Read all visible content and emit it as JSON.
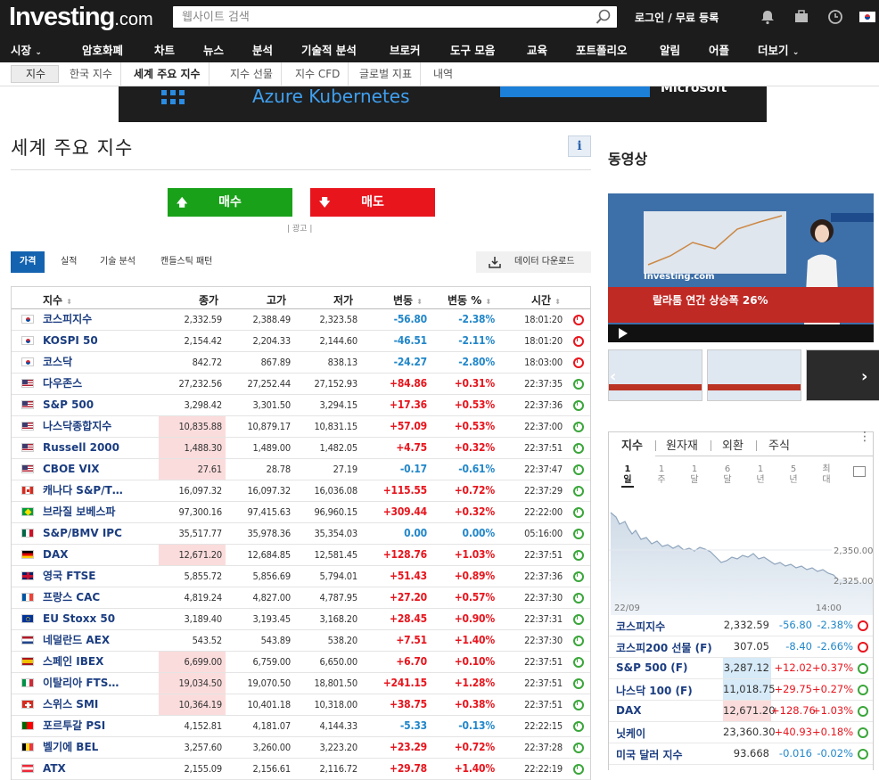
{
  "header": {
    "logo_main": "Investing",
    "logo_suffix": ".com",
    "search_placeholder": "웹사이트 검색",
    "login": "로그인",
    "sep": "/",
    "signup": "무료 등록"
  },
  "nav": {
    "items": [
      "시장",
      "암호화폐",
      "차트",
      "뉴스",
      "분석",
      "기술적 분석",
      "브로커",
      "도구 모음",
      "교육",
      "포트폴리오",
      "알림",
      "어플",
      "더보기"
    ]
  },
  "subnav": {
    "crumb": "지수",
    "tabs": [
      "한국 지수",
      "세계 주요 지수",
      "지수 선물",
      "지수 CFD",
      "글로벌 지표",
      "내역"
    ],
    "active": 1
  },
  "banner": {
    "text": "Azure Kubernetes",
    "brand": "Microsoft"
  },
  "page": {
    "title": "세계 주요 지수",
    "info": "i",
    "buy": "매수",
    "sell": "매도",
    "ad": "| 광고 |",
    "tabs": [
      "가격",
      "실적",
      "기술 분석",
      "캔들스틱 패턴"
    ],
    "download": "데이터 다운로드"
  },
  "table": {
    "headers": [
      "지수",
      "종가",
      "고가",
      "저가",
      "변동",
      "변동 %",
      "시간"
    ],
    "rows": [
      {
        "flag": "kr",
        "name": "코스피지수",
        "last": "2,332.59",
        "high": "2,388.49",
        "low": "2,323.58",
        "chg": "-56.80",
        "pct": "-2.38%",
        "time": "18:01:20",
        "open": false,
        "hl": false
      },
      {
        "flag": "kr",
        "name": "KOSPI 50",
        "last": "2,154.42",
        "high": "2,204.33",
        "low": "2,144.60",
        "chg": "-46.51",
        "pct": "-2.11%",
        "time": "18:01:20",
        "open": false,
        "hl": false
      },
      {
        "flag": "kr",
        "name": "코스닥",
        "last": "842.72",
        "high": "867.89",
        "low": "838.13",
        "chg": "-24.27",
        "pct": "-2.80%",
        "time": "18:03:00",
        "open": false,
        "hl": false
      },
      {
        "flag": "us",
        "name": "다우존스",
        "last": "27,232.56",
        "high": "27,252.44",
        "low": "27,152.93",
        "chg": "+84.86",
        "pct": "+0.31%",
        "time": "22:37:35",
        "open": true,
        "hl": false
      },
      {
        "flag": "us",
        "name": "S&P 500",
        "last": "3,298.42",
        "high": "3,301.50",
        "low": "3,294.15",
        "chg": "+17.36",
        "pct": "+0.53%",
        "time": "22:37:36",
        "open": true,
        "hl": false
      },
      {
        "flag": "us",
        "name": "나스닥종합지수",
        "last": "10,835.88",
        "high": "10,879.17",
        "low": "10,831.15",
        "chg": "+57.09",
        "pct": "+0.53%",
        "time": "22:37:00",
        "open": true,
        "hl": true
      },
      {
        "flag": "us",
        "name": "Russell 2000",
        "last": "1,488.30",
        "high": "1,489.00",
        "low": "1,482.05",
        "chg": "+4.75",
        "pct": "+0.32%",
        "time": "22:37:51",
        "open": true,
        "hl": true
      },
      {
        "flag": "us",
        "name": "CBOE VIX",
        "last": "27.61",
        "high": "28.78",
        "low": "27.19",
        "chg": "-0.17",
        "pct": "-0.61%",
        "time": "22:37:47",
        "open": true,
        "hl": true
      },
      {
        "flag": "ca",
        "name": "캐나다 S&P/T…",
        "last": "16,097.32",
        "high": "16,097.32",
        "low": "16,036.08",
        "chg": "+115.55",
        "pct": "+0.72%",
        "time": "22:37:29",
        "open": true,
        "hl": false
      },
      {
        "flag": "br",
        "name": "브라질 보베스파",
        "last": "97,300.16",
        "high": "97,415.63",
        "low": "96,960.15",
        "chg": "+309.44",
        "pct": "+0.32%",
        "time": "22:22:00",
        "open": true,
        "hl": false
      },
      {
        "flag": "mx",
        "name": "S&P/BMV IPC",
        "last": "35,517.77",
        "high": "35,978.36",
        "low": "35,354.03",
        "chg": "0.00",
        "pct": "0.00%",
        "time": "05:16:00",
        "open": true,
        "hl": false
      },
      {
        "flag": "de",
        "name": "DAX",
        "last": "12,671.20",
        "high": "12,684.85",
        "low": "12,581.45",
        "chg": "+128.76",
        "pct": "+1.03%",
        "time": "22:37:51",
        "open": true,
        "hl": true
      },
      {
        "flag": "gb",
        "name": "영국 FTSE",
        "last": "5,855.72",
        "high": "5,856.69",
        "low": "5,794.01",
        "chg": "+51.43",
        "pct": "+0.89%",
        "time": "22:37:36",
        "open": true,
        "hl": false
      },
      {
        "flag": "fr",
        "name": "프랑스 CAC",
        "last": "4,819.24",
        "high": "4,827.00",
        "low": "4,787.95",
        "chg": "+27.20",
        "pct": "+0.57%",
        "time": "22:37:30",
        "open": true,
        "hl": false
      },
      {
        "flag": "eu",
        "name": "EU Stoxx 50",
        "last": "3,189.40",
        "high": "3,193.45",
        "low": "3,168.20",
        "chg": "+28.45",
        "pct": "+0.90%",
        "time": "22:37:31",
        "open": true,
        "hl": false
      },
      {
        "flag": "nl",
        "name": "네덜란드 AEX",
        "last": "543.52",
        "high": "543.89",
        "low": "538.20",
        "chg": "+7.51",
        "pct": "+1.40%",
        "time": "22:37:30",
        "open": true,
        "hl": false
      },
      {
        "flag": "es",
        "name": "스페인 IBEX",
        "last": "6,699.00",
        "high": "6,759.00",
        "low": "6,650.00",
        "chg": "+6.70",
        "pct": "+0.10%",
        "time": "22:37:51",
        "open": true,
        "hl": true
      },
      {
        "flag": "it",
        "name": "이탈리아 FTS…",
        "last": "19,034.50",
        "high": "19,070.50",
        "low": "18,801.50",
        "chg": "+241.15",
        "pct": "+1.28%",
        "time": "22:37:51",
        "open": true,
        "hl": true
      },
      {
        "flag": "ch",
        "name": "스위스 SMI",
        "last": "10,364.19",
        "high": "10,401.18",
        "low": "10,318.00",
        "chg": "+38.75",
        "pct": "+0.38%",
        "time": "22:37:51",
        "open": true,
        "hl": true
      },
      {
        "flag": "pt",
        "name": "포르투갈 PSI",
        "last": "4,152.81",
        "high": "4,181.07",
        "low": "4,144.33",
        "chg": "-5.33",
        "pct": "-0.13%",
        "time": "22:22:15",
        "open": true,
        "hl": false
      },
      {
        "flag": "be",
        "name": "벨기에 BEL",
        "last": "3,257.60",
        "high": "3,260.00",
        "low": "3,223.20",
        "chg": "+23.29",
        "pct": "+0.72%",
        "time": "22:37:28",
        "open": true,
        "hl": false
      },
      {
        "flag": "at",
        "name": "ATX",
        "last": "2,155.09",
        "high": "2,156.61",
        "low": "2,116.72",
        "chg": "+29.78",
        "pct": "+1.40%",
        "time": "22:22:19",
        "open": true,
        "hl": false
      }
    ]
  },
  "sidebar": {
    "video_title": "동영상",
    "video_caption": "랄라툼 연간 상승폭 26%",
    "video_logo": "Investing.com",
    "widget_tabs": [
      "지수",
      "원자재",
      "외환",
      "주식"
    ],
    "periods": [
      "1일",
      "1주",
      "1달",
      "6달",
      "1년",
      "5년",
      "최대"
    ],
    "y_labels": [
      "2,350.00",
      "2,325.00"
    ],
    "x_labels": [
      "22/09",
      "14:00"
    ],
    "rows": [
      {
        "name": "코스피지수",
        "last": "2,332.59",
        "chg": "-56.80",
        "pct": "-2.38%",
        "open": false,
        "bg": ""
      },
      {
        "name": "코스피200 선물 (F)",
        "last": "307.05",
        "chg": "-8.40",
        "pct": "-2.66%",
        "open": false,
        "bg": ""
      },
      {
        "name": "S&P 500 (F)",
        "last": "3,287.12",
        "chg": "+12.02",
        "pct": "+0.37%",
        "open": true,
        "bg": "blue"
      },
      {
        "name": "나스닥 100 (F)",
        "last": "11,018.75",
        "chg": "+29.75",
        "pct": "+0.27%",
        "open": true,
        "bg": "blue"
      },
      {
        "name": "DAX",
        "last": "12,671.20",
        "chg": "+128.76",
        "pct": "+1.03%",
        "open": true,
        "bg": "pink"
      },
      {
        "name": "닛케이",
        "last": "23,360.30",
        "chg": "+40.93",
        "pct": "+0.18%",
        "open": true,
        "bg": ""
      },
      {
        "name": "미국 달러 지수",
        "last": "93.668",
        "chg": "-0.016",
        "pct": "-0.02%",
        "open": true,
        "bg": ""
      }
    ]
  },
  "colors": {
    "up": "#e8151d",
    "down": "#2287ca",
    "buy": "#19a119",
    "sell": "#e8151d",
    "accent": "#1463b0"
  }
}
